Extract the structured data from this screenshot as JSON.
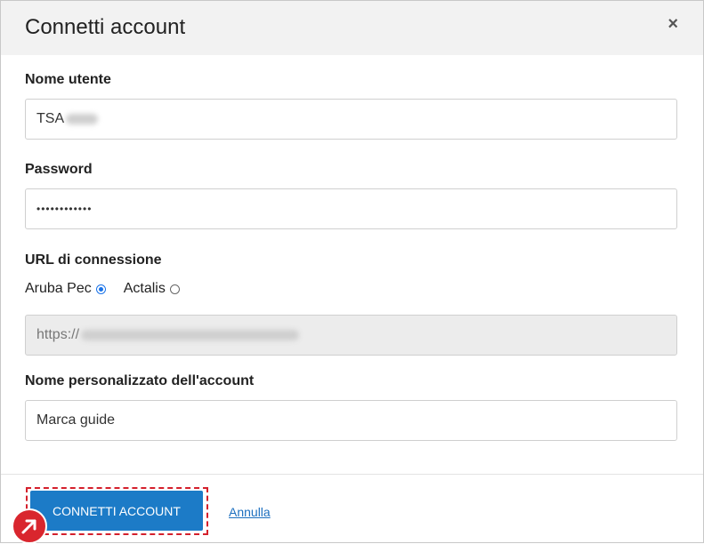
{
  "dialog": {
    "title": "Connetti account",
    "close_label": "×"
  },
  "fields": {
    "username": {
      "label": "Nome utente",
      "value": "TSA"
    },
    "password": {
      "label": "Password",
      "value": "••••••••••••"
    },
    "url": {
      "label": "URL di connessione",
      "options": [
        {
          "label": "Aruba Pec",
          "checked": true
        },
        {
          "label": "Actalis",
          "checked": false
        }
      ],
      "value": "https://"
    },
    "account_name": {
      "label": "Nome personalizzato dell'account",
      "value": "Marca guide"
    }
  },
  "footer": {
    "connect_label": "CONNETTI ACCOUNT",
    "cancel_label": "Annulla"
  },
  "colors": {
    "primary": "#1c7bc7",
    "highlight": "#d4202c",
    "radio_checked": "#1a73e8"
  },
  "icons": {
    "close": "close-icon",
    "badge": "arrow-up-right-icon"
  }
}
